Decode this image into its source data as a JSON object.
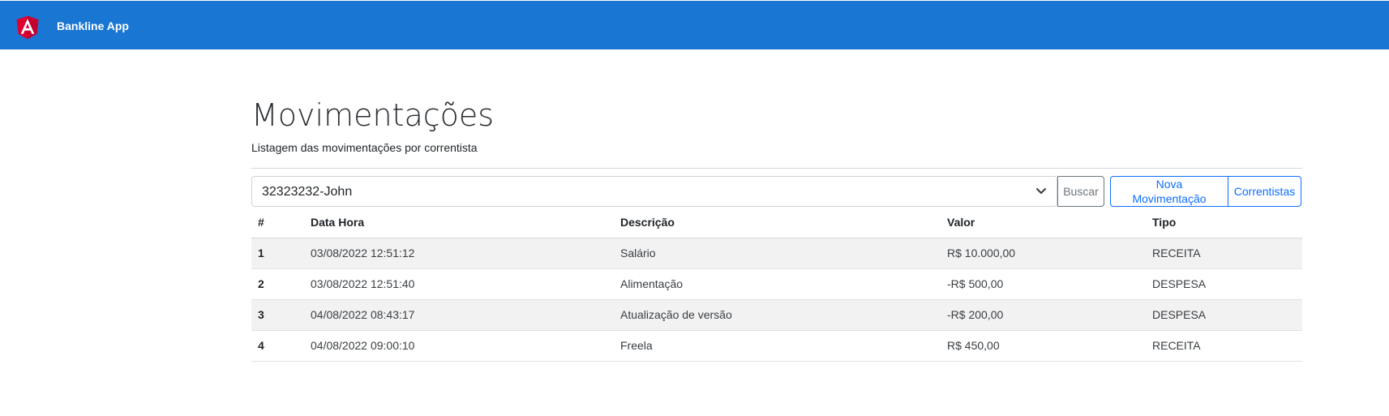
{
  "header": {
    "app_title": "Bankline App",
    "brand_color": "#1976d2",
    "logo_icon": "angular-logo-icon"
  },
  "page": {
    "title": "Movimentações",
    "subtitle": "Listagem das movimentações por correntista"
  },
  "filter": {
    "selected_correntista": "32323232-John",
    "search_button": "Buscar"
  },
  "actions": {
    "new_movement": "Nova Movimentação",
    "account_holders": "Correntistas"
  },
  "table": {
    "columns": [
      "#",
      "Data Hora",
      "Descrição",
      "Valor",
      "Tipo"
    ],
    "rows": [
      {
        "id": "1",
        "datetime": "03/08/2022 12:51:12",
        "description": "Salário",
        "value": "R$ 10.000,00",
        "type": "RECEITA"
      },
      {
        "id": "2",
        "datetime": "03/08/2022 12:51:40",
        "description": "Alimentação",
        "value": "-R$ 500,00",
        "type": "DESPESA"
      },
      {
        "id": "3",
        "datetime": "04/08/2022 08:43:17",
        "description": "Atualização de versão",
        "value": "-R$ 200,00",
        "type": "DESPESA"
      },
      {
        "id": "4",
        "datetime": "04/08/2022 09:00:10",
        "description": "Freela",
        "value": "R$ 450,00",
        "type": "RECEITA"
      }
    ],
    "income_color": "#0000ff",
    "expense_color": "#ff0000"
  }
}
